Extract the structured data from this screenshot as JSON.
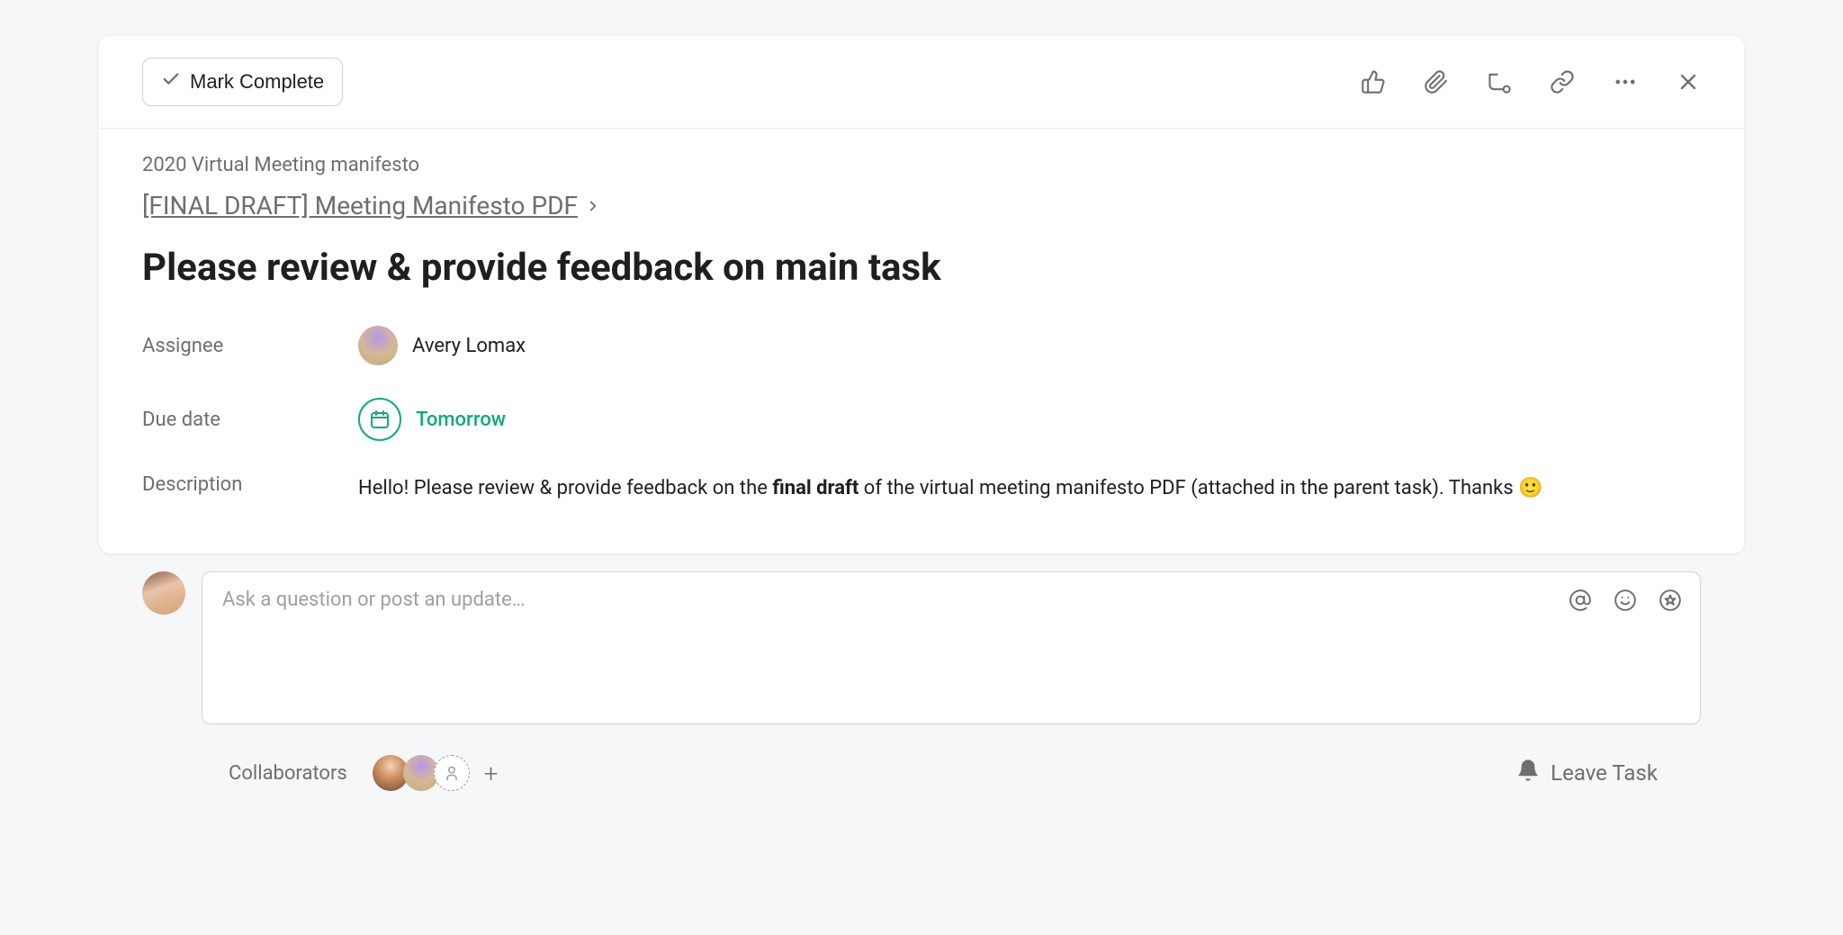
{
  "toolbar": {
    "mark_complete": "Mark Complete"
  },
  "breadcrumb": {
    "project": "2020 Virtual Meeting manifesto",
    "parent_task": "[FINAL DRAFT] Meeting Manifesto PDF"
  },
  "task": {
    "title": "Please review & provide feedback on main task"
  },
  "fields": {
    "assignee_label": "Assignee",
    "assignee_name": "Avery Lomax",
    "due_label": "Due date",
    "due_value": "Tomorrow",
    "desc_label": "Description",
    "desc_pre": "Hello! Please review & provide feedback on the ",
    "desc_bold": "final draft",
    "desc_post": " of the virtual meeting manifesto PDF (attached in the parent task). Thanks 🙂"
  },
  "comment": {
    "placeholder": "Ask a question or post an update…"
  },
  "footer": {
    "collaborators_label": "Collaborators",
    "leave_task": "Leave Task"
  }
}
